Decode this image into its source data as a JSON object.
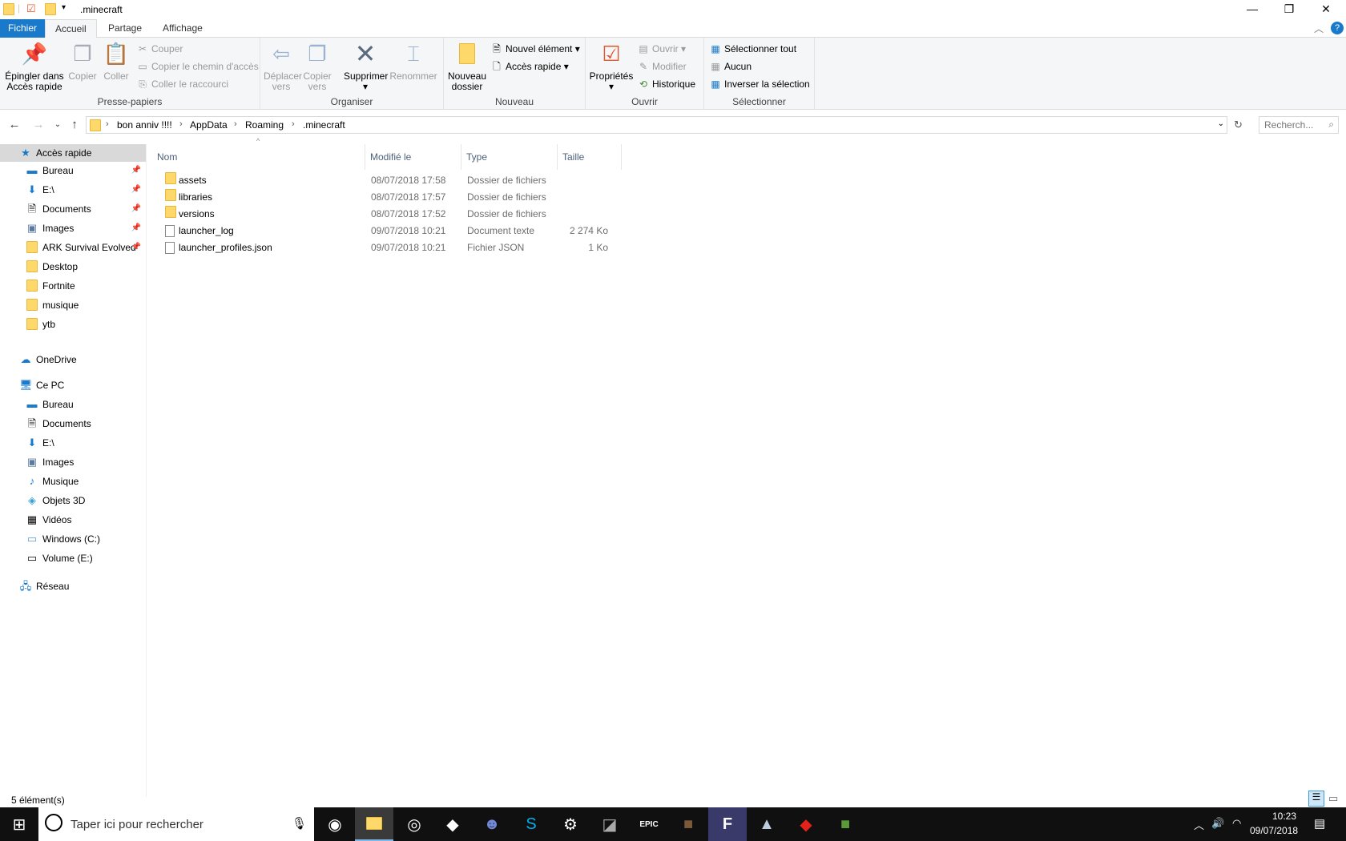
{
  "window": {
    "title": ".minecraft"
  },
  "tabs": [
    {
      "label": "Fichier"
    },
    {
      "label": "Accueil"
    },
    {
      "label": "Partage"
    },
    {
      "label": "Affichage"
    }
  ],
  "ribbon": {
    "clipboard": {
      "label": "Presse-papiers",
      "pin": "Épingler dans Accès rapide",
      "pin1": "Épingler dans",
      "pin2": "Accès rapide",
      "copy": "Copier",
      "paste": "Coller",
      "cut": "Couper",
      "copy_path": "Copier le chemin d'accès",
      "paste_shortcut": "Coller le raccourci"
    },
    "organize": {
      "label": "Organiser",
      "move1": "Déplacer",
      "move2": "vers",
      "copyto1": "Copier",
      "copyto2": "vers",
      "delete": "Supprimer",
      "rename": "Renommer"
    },
    "new": {
      "label": "Nouveau",
      "new_folder1": "Nouveau",
      "new_folder2": "dossier",
      "new_item": "Nouvel élément",
      "quick_access": "Accès rapide"
    },
    "open": {
      "label": "Ouvrir",
      "properties": "Propriétés",
      "open": "Ouvrir",
      "edit": "Modifier",
      "history": "Historique"
    },
    "select": {
      "label": "Sélectionner",
      "select_all": "Sélectionner tout",
      "none": "Aucun",
      "invert": "Inverser la sélection"
    }
  },
  "address": {
    "crumbs": [
      "bon anniv !!!!",
      "AppData",
      "Roaming",
      ".minecraft"
    ],
    "search_placeholder": "Recherch..."
  },
  "sidebar": {
    "quick_access": "Accès rapide",
    "quick_items": [
      {
        "label": "Bureau",
        "pinned": true
      },
      {
        "label": "E:\\",
        "pinned": true
      },
      {
        "label": "Documents",
        "pinned": true
      },
      {
        "label": "Images",
        "pinned": true
      },
      {
        "label": "ARK  Survival Evolved",
        "pinned": true
      },
      {
        "label": "Desktop"
      },
      {
        "label": "Fortnite"
      },
      {
        "label": "musique"
      },
      {
        "label": "ytb"
      }
    ],
    "onedrive": "OneDrive",
    "this_pc": "Ce PC",
    "pc_items": [
      {
        "label": "Bureau"
      },
      {
        "label": "Documents"
      },
      {
        "label": "E:\\"
      },
      {
        "label": "Images"
      },
      {
        "label": "Musique"
      },
      {
        "label": "Objets 3D"
      },
      {
        "label": "Vidéos"
      },
      {
        "label": "Windows (C:)"
      },
      {
        "label": "Volume (E:)"
      }
    ],
    "network": "Réseau"
  },
  "files": {
    "columns": [
      "Nom",
      "Modifié le",
      "Type",
      "Taille"
    ],
    "rows": [
      {
        "name": "assets",
        "modified": "08/07/2018 17:58",
        "type": "Dossier de fichiers",
        "size": "",
        "icon": "folder"
      },
      {
        "name": "libraries",
        "modified": "08/07/2018 17:57",
        "type": "Dossier de fichiers",
        "size": "",
        "icon": "folder"
      },
      {
        "name": "versions",
        "modified": "08/07/2018 17:52",
        "type": "Dossier de fichiers",
        "size": "",
        "icon": "folder"
      },
      {
        "name": "launcher_log",
        "modified": "09/07/2018 10:21",
        "type": "Document texte",
        "size": "2 274 Ko",
        "icon": "text-file"
      },
      {
        "name": "launcher_profiles.json",
        "modified": "09/07/2018 10:21",
        "type": "Fichier JSON",
        "size": "1 Ko",
        "icon": "file"
      }
    ]
  },
  "status": {
    "count": "5 élément(s)"
  },
  "taskbar": {
    "search_placeholder": "Taper ici pour rechercher",
    "time": "10:23",
    "date": "09/07/2018"
  },
  "colors": {
    "accent": "#1979ca",
    "taskbar": "#101010",
    "selected": "#d9d9d9"
  }
}
